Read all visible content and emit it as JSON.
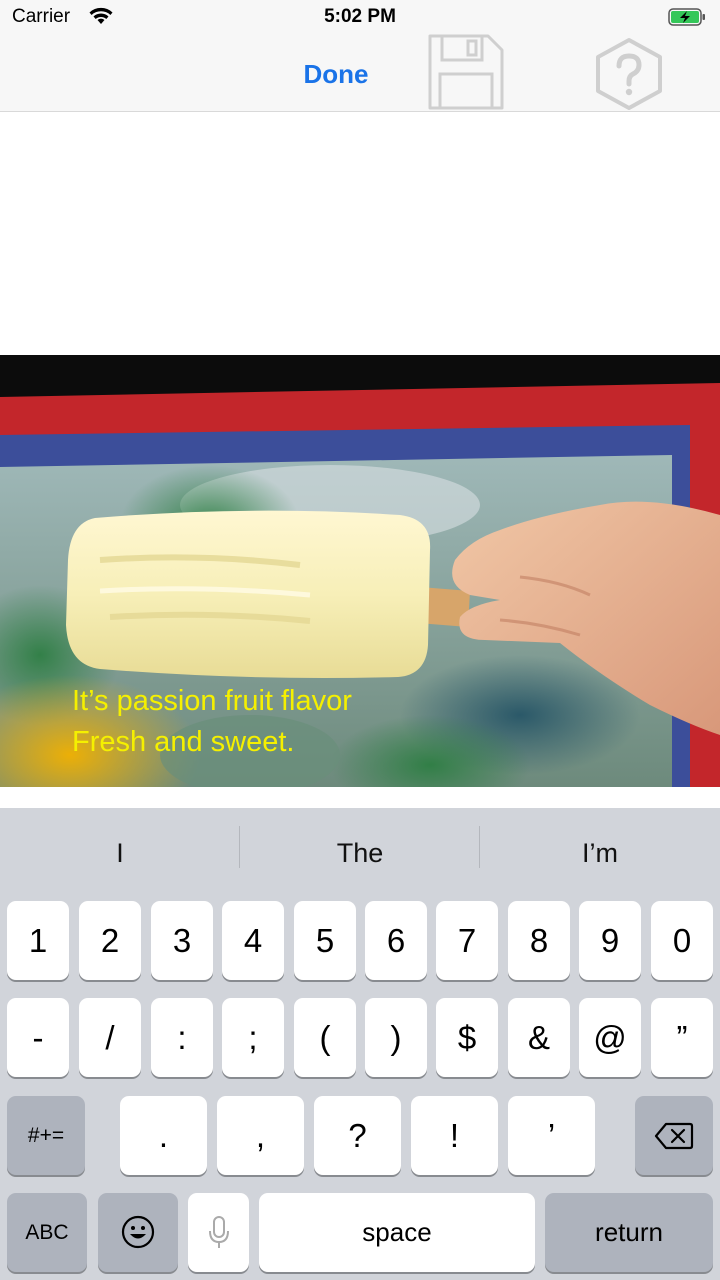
{
  "status_bar": {
    "carrier": "Carrier",
    "time": "5:02 PM"
  },
  "nav_bar": {
    "done_label": "Done"
  },
  "photo": {
    "caption_line1": "It’s passion fruit flavor",
    "caption_line2": "Fresh and sweet."
  },
  "keyboard": {
    "suggestions": [
      "I",
      "The",
      "I’m"
    ],
    "row1": [
      "1",
      "2",
      "3",
      "4",
      "5",
      "6",
      "7",
      "8",
      "9",
      "0"
    ],
    "row2": [
      "-",
      "/",
      ":",
      ";",
      "(",
      ")",
      "$",
      "&",
      "@",
      "”"
    ],
    "row3": [
      ".",
      ",",
      "?",
      "!",
      "’"
    ],
    "symbols_label": "#+=",
    "abc_label": "ABC",
    "space_label": "space",
    "return_label": "return"
  },
  "colors": {
    "accent": "#1a73e8",
    "caption": "#f5f000",
    "keyboard_bg": "#d1d4da"
  }
}
